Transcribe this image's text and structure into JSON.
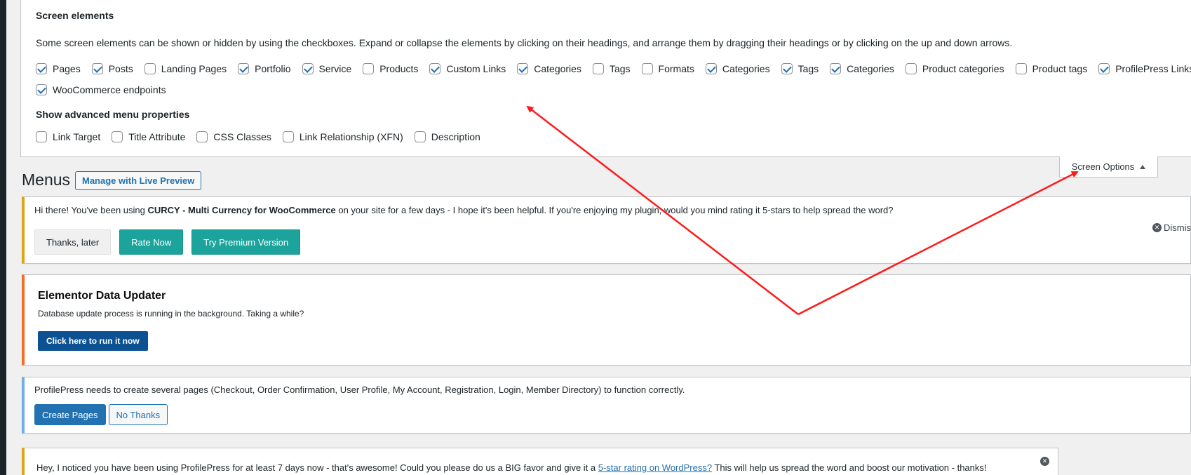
{
  "screen_options_panel": {
    "heading": "Screen elements",
    "description": "Some screen elements can be shown or hidden by using the checkboxes. Expand or collapse the elements by clicking on their headings, and arrange them by dragging their headings or by clicking on the up and down arrows.",
    "elements": [
      {
        "label": "Pages",
        "checked": true
      },
      {
        "label": "Posts",
        "checked": true
      },
      {
        "label": "Landing Pages",
        "checked": false
      },
      {
        "label": "Portfolio",
        "checked": true
      },
      {
        "label": "Service",
        "checked": true
      },
      {
        "label": "Products",
        "checked": false
      },
      {
        "label": "Custom Links",
        "checked": true
      },
      {
        "label": "Categories",
        "checked": true
      },
      {
        "label": "Tags",
        "checked": false
      },
      {
        "label": "Formats",
        "checked": false
      },
      {
        "label": "Categories",
        "checked": true
      },
      {
        "label": "Tags",
        "checked": true
      },
      {
        "label": "Categories",
        "checked": true
      },
      {
        "label": "Product categories",
        "checked": false
      },
      {
        "label": "Product tags",
        "checked": false
      },
      {
        "label": "ProfilePress Links",
        "checked": true
      },
      {
        "label": "WooCommerce endpoints",
        "checked": true
      }
    ],
    "advanced_heading": "Show advanced menu properties",
    "advanced": [
      {
        "label": "Link Target",
        "checked": false
      },
      {
        "label": "Title Attribute",
        "checked": false
      },
      {
        "label": "CSS Classes",
        "checked": false
      },
      {
        "label": "Link Relationship (XFN)",
        "checked": false
      },
      {
        "label": "Description",
        "checked": false
      }
    ]
  },
  "screen_options_tab": {
    "label": "Screen Options"
  },
  "page": {
    "title": "Menus",
    "live_preview_button": "Manage with Live Preview"
  },
  "curcy_notice": {
    "text_prefix": "Hi there! You've been using ",
    "plugin_name": "CURCY - Multi Currency for WooCommerce",
    "text_suffix": " on your site for a few days - I hope it's been helpful. If you're enjoying my plugin, would you mind rating it 5-stars to help spread the word?",
    "btn_later": "Thanks, later",
    "btn_rate": "Rate Now",
    "btn_premium": "Try Premium Version",
    "dismiss": "Dismiss"
  },
  "elementor_notice": {
    "title": "Elementor Data Updater",
    "description": "Database update process is running in the background. Taking a while?",
    "button": "Click here to run it now"
  },
  "profilepress_notice": {
    "text": "ProfilePress needs to create several pages (Checkout, Order Confirmation, User Profile, My Account, Registration, Login, Member Directory) to function correctly.",
    "btn_create": "Create Pages",
    "btn_no": "No Thanks"
  },
  "profilepress_review_notice": {
    "text_prefix": "Hey, I noticed you have been using ProfilePress for at least 7 days now - that's awesome! Could you please do us a BIG favor and give it a ",
    "link": "5-star rating on WordPress?",
    "text_suffix": " This will help us spread the word and boost our motivation - thanks!"
  },
  "colors": {
    "annotation_arrow": "#ff1a1a",
    "teal_button": "#1ba39c",
    "wp_blue": "#2271b1",
    "elementor_accent": "#f56e28",
    "warning_accent": "#dba617"
  }
}
